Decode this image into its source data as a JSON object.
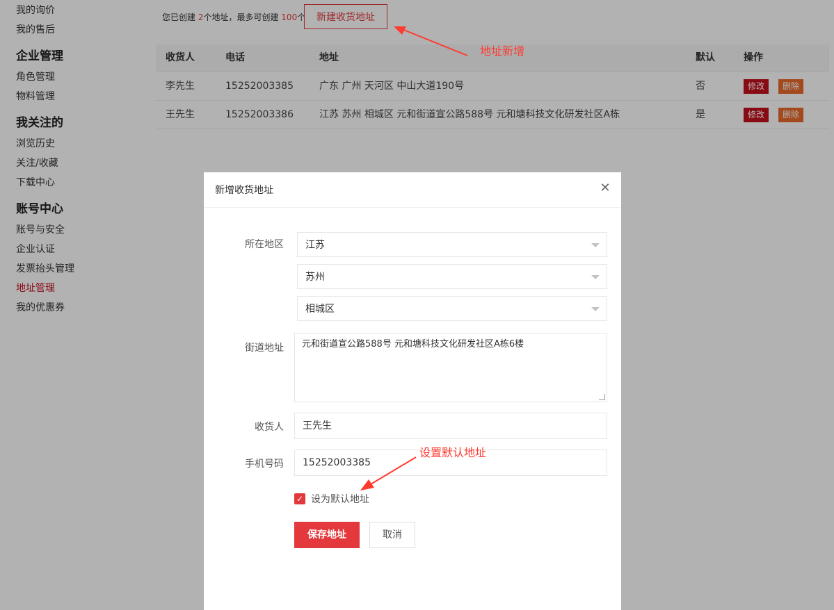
{
  "sidebar": {
    "items_top": [
      {
        "label": "我的询价"
      },
      {
        "label": "我的售后"
      }
    ],
    "sections": [
      {
        "heading": "企业管理",
        "items": [
          "角色管理",
          "物料管理"
        ]
      },
      {
        "heading": "我关注的",
        "items": [
          "浏览历史",
          "关注/收藏",
          "下载中心"
        ]
      },
      {
        "heading": "账号中心",
        "items": [
          "账号与安全",
          "企业认证",
          "发票抬头管理",
          "地址管理",
          "我的优惠券"
        ]
      }
    ],
    "active_item": "地址管理"
  },
  "summary": {
    "prefix": "您已创建 ",
    "created": "2",
    "middle": "个地址，最多可创建 ",
    "max": "100",
    "suffix": "个",
    "new_button": "新建收货地址"
  },
  "table": {
    "headers": {
      "name": "收货人",
      "phone": "电话",
      "address": "地址",
      "default": "默认",
      "ops": "操作"
    },
    "rows": [
      {
        "name": "李先生",
        "phone": "15252003385",
        "address": "广东 广州 天河区 中山大道190号",
        "default": "否",
        "edit": "修改",
        "delete": "删除"
      },
      {
        "name": "王先生",
        "phone": "15252003386",
        "address": "江苏 苏州 相城区 元和街道宣公路588号 元和塘科技文化研发社区A栋",
        "default": "是",
        "edit": "修改",
        "delete": "删除"
      }
    ]
  },
  "modal": {
    "title": "新增收货地址",
    "region_label": "所在地区",
    "province": "江苏",
    "city": "苏州",
    "district": "相城区",
    "street_label": "街道地址",
    "street_value": "元和街道宣公路588号 元和塘科技文化研发社区A栋6楼",
    "receiver_label": "收货人",
    "receiver_value": "王先生",
    "phone_label": "手机号码",
    "phone_value": "15252003385",
    "default_checked": true,
    "default_label": "设为默认地址",
    "save_button": "保存地址",
    "cancel_button": "取消"
  },
  "annotations": {
    "new_address": "地址新增",
    "set_default": "设置默认地址"
  },
  "colors": {
    "accent": "#e4393c",
    "active_nav": "#c3111d",
    "delete": "#e8692c",
    "annotation": "#ff3b30"
  }
}
